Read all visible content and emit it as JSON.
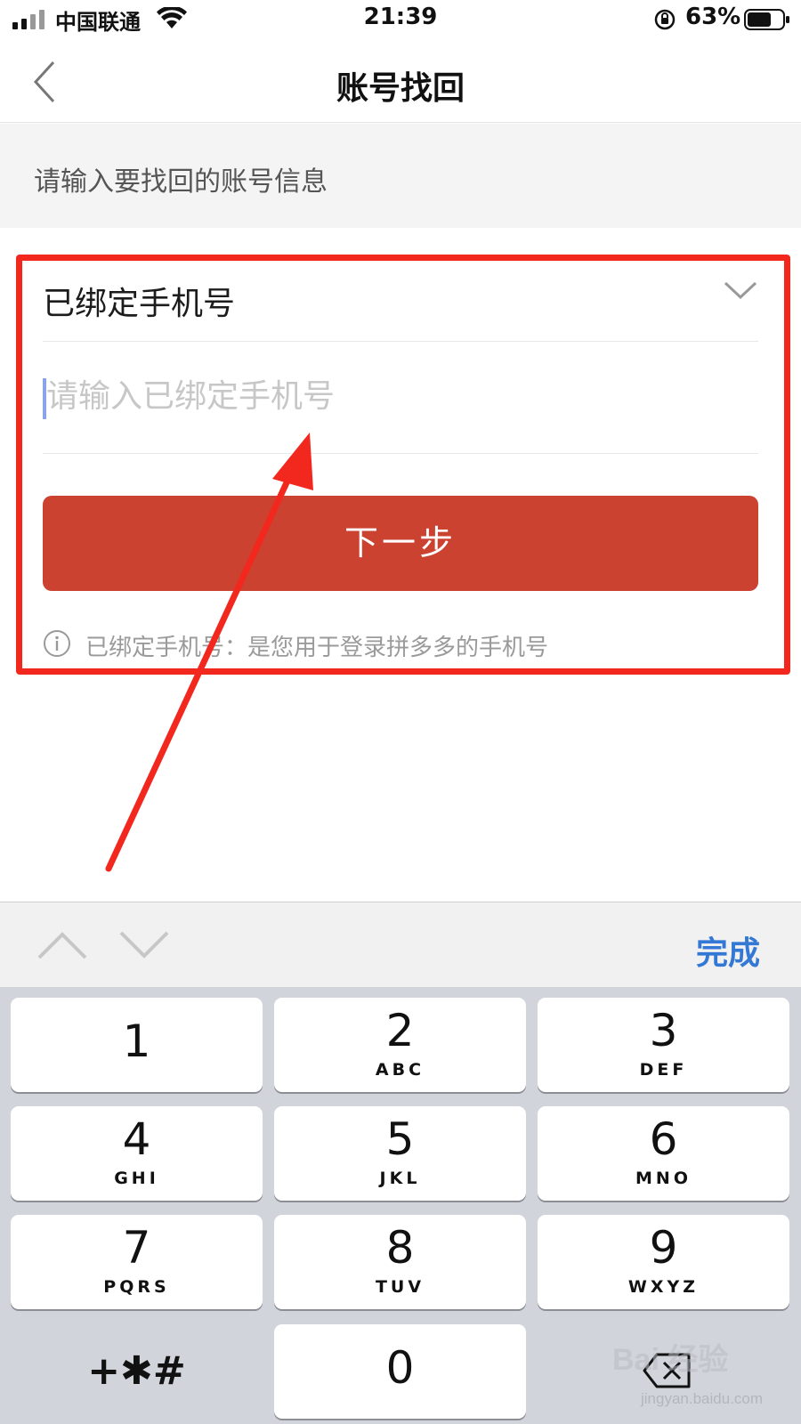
{
  "status_bar": {
    "carrier": "中国联通",
    "time": "21:39",
    "battery_percent": "63%"
  },
  "nav": {
    "title": "账号找回",
    "back_icon": "chevron-left-icon"
  },
  "hint": {
    "text": "请输入要找回的账号信息"
  },
  "form": {
    "account_type_label": "已绑定手机号",
    "phone_placeholder": "请输入已绑定手机号",
    "phone_value": "",
    "next_button_label": "下一步",
    "info_text": "已绑定手机号：是您用于登录拼多多的手机号"
  },
  "keyboard": {
    "done_label": "完成",
    "keys": [
      {
        "digit": "1",
        "letters": ""
      },
      {
        "digit": "2",
        "letters": "ABC"
      },
      {
        "digit": "3",
        "letters": "DEF"
      },
      {
        "digit": "4",
        "letters": "GHI"
      },
      {
        "digit": "5",
        "letters": "JKL"
      },
      {
        "digit": "6",
        "letters": "MNO"
      },
      {
        "digit": "7",
        "letters": "PQRS"
      },
      {
        "digit": "8",
        "letters": "TUV"
      },
      {
        "digit": "9",
        "letters": "WXYZ"
      },
      {
        "digit": "0",
        "letters": ""
      }
    ],
    "symbol_key": "+✱#"
  },
  "watermark": {
    "logo": "Bai  经验",
    "url": "jingyan.baidu.com"
  },
  "colors": {
    "highlight_frame": "#f2271d",
    "next_button": "#cb4230",
    "done_link": "#3478d6",
    "arrow": "#f2271d"
  }
}
